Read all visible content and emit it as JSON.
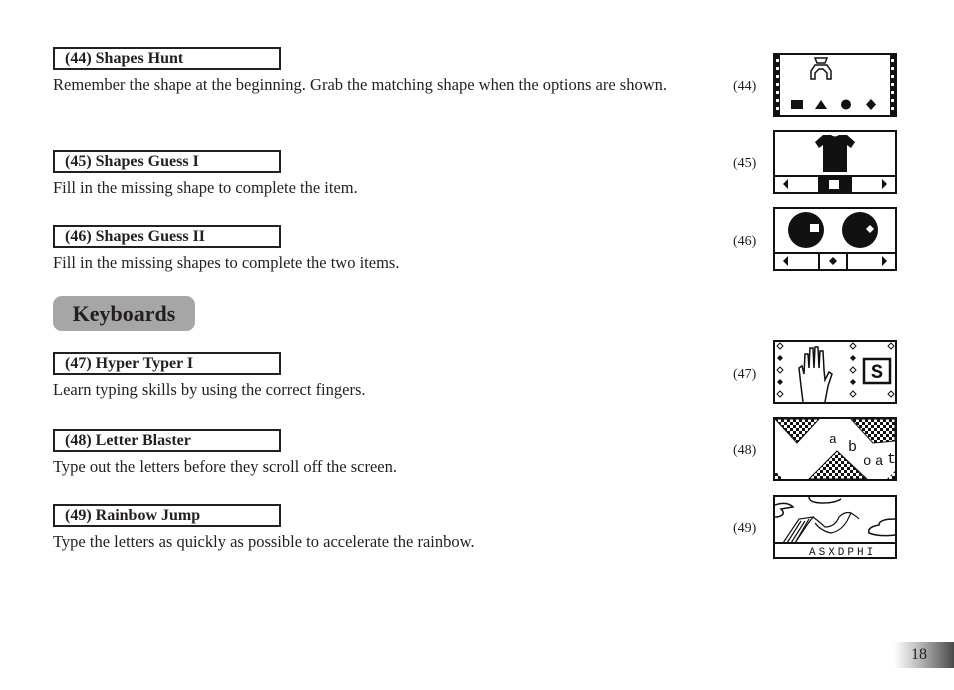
{
  "entries": [
    {
      "title": "(44) Shapes Hunt",
      "description": "Remember the shape at the beginning. Grab the matching shape when the options are shown.",
      "screen_label": "(44)"
    },
    {
      "title": "(45) Shapes Guess I",
      "description": "Fill in the missing shape to complete the item.",
      "screen_label": "(45)"
    },
    {
      "title": "(46) Shapes Guess II",
      "description": "Fill in the missing shapes to complete the two items.",
      "screen_label": "(46)"
    },
    {
      "title": "(47) Hyper Typer I",
      "description": "Learn typing skills by using the correct fingers.",
      "screen_label": "(47)"
    },
    {
      "title": "(48) Letter Blaster",
      "description": "Type out the letters before they scroll off the screen.",
      "screen_label": "(48)"
    },
    {
      "title": "(49) Rainbow Jump",
      "description": "Type the letters as quickly as possible to accelerate the rainbow.",
      "screen_label": "(49)"
    }
  ],
  "section_heading": "Keyboards",
  "screens": {
    "hyper_typer_letter": "S",
    "letter_blaster_letters": [
      "a",
      "b",
      "o",
      "a",
      "t"
    ],
    "rainbow_jump_letters": "ASXDPHI"
  },
  "page_number": "18"
}
